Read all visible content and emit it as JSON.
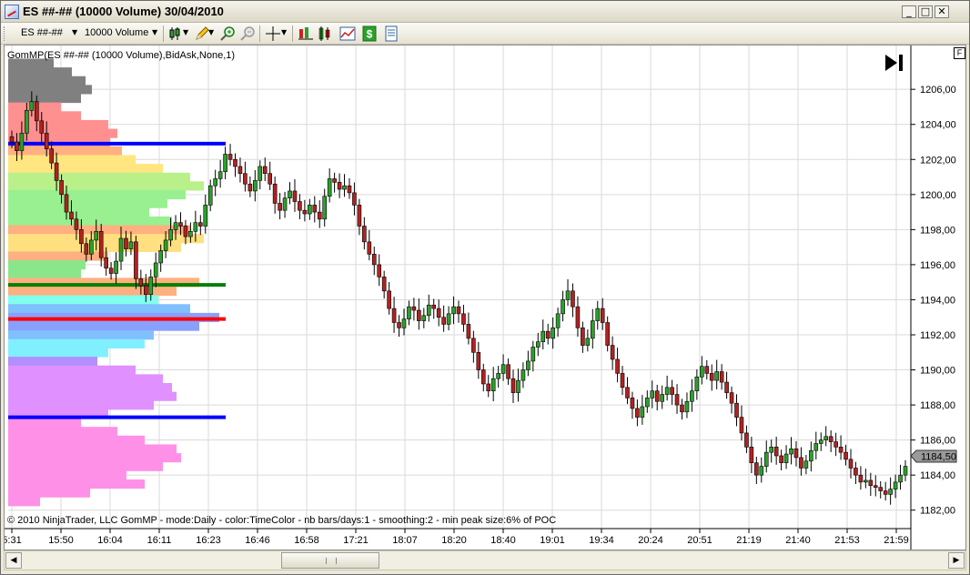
{
  "window": {
    "title": "ES ##-## (10000 Volume)  30/04/2010",
    "minimize": "_",
    "maximize": "□",
    "close": "✕"
  },
  "toolbar": {
    "instrument": "ES ##-##",
    "period": "10000 Volume",
    "icons": [
      "candlestick-icon",
      "pencil-icon",
      "zoom-in-icon",
      "zoom-out-icon",
      "crosshair-icon",
      "bar-type-icon",
      "indicators-icon",
      "strategy-icon",
      "dollar-icon",
      "properties-icon"
    ]
  },
  "chart": {
    "indicator_label": "GomMP(ES ##-## (10000 Volume),BidAsk,None,1)",
    "footer": "© 2010 NinjaTrader, LLC     GomMP - mode:Daily - color:TimeColor - nb bars/days:1 - smoothing:2 - min peak size:6% of POC",
    "f_button": "F",
    "last_price": "1184,50"
  },
  "chart_data": {
    "type": "candlestick",
    "instrument": "ES ##-##",
    "y_ticks": [
      "1206,00",
      "1204,00",
      "1202,00",
      "1200,00",
      "1198,00",
      "1196,00",
      "1194,00",
      "1192,00",
      "1190,00",
      "1188,00",
      "1186,00",
      "1184,00",
      "1182,00"
    ],
    "x_ticks": [
      "5:31",
      "15:50",
      "16:04",
      "16:11",
      "16:23",
      "16:46",
      "16:58",
      "17:21",
      "18:07",
      "18:20",
      "18:40",
      "19:01",
      "19:34",
      "20:24",
      "20:51",
      "21:19",
      "21:40",
      "21:53",
      "21:59"
    ],
    "ylim": [
      1181,
      1208.5
    ],
    "last": 1184.5,
    "levels": [
      {
        "price": 1202.9,
        "color": "#0000ff"
      },
      {
        "price": 1194.85,
        "color": "#008000"
      },
      {
        "price": 1192.9,
        "color": "#ff0000"
      },
      {
        "price": 1187.3,
        "color": "#0000ff"
      }
    ],
    "closes": [
      1203.0,
      1202.5,
      1203.5,
      1204.8,
      1205.3,
      1204.2,
      1203.5,
      1202.6,
      1201.8,
      1200.8,
      1200.0,
      1199.0,
      1198.6,
      1198.0,
      1197.2,
      1196.6,
      1197.4,
      1197.9,
      1196.4,
      1195.8,
      1195.5,
      1196.2,
      1197.5,
      1196.9,
      1197.3,
      1195.2,
      1194.8,
      1194.3,
      1195.3,
      1196.1,
      1196.8,
      1197.4,
      1198.0,
      1198.4,
      1198.2,
      1197.6,
      1197.9,
      1198.4,
      1198.2,
      1199.4,
      1200.5,
      1200.9,
      1201.3,
      1202.3,
      1202.0,
      1201.6,
      1201.2,
      1200.6,
      1200.2,
      1200.8,
      1201.6,
      1201.2,
      1200.6,
      1199.5,
      1199.1,
      1199.8,
      1200.2,
      1199.6,
      1199.1,
      1198.9,
      1199.4,
      1199.0,
      1198.6,
      1199.9,
      1200.9,
      1200.7,
      1200.3,
      1200.5,
      1200.1,
      1199.4,
      1198.2,
      1197.3,
      1196.6,
      1196.0,
      1195.3,
      1194.5,
      1193.5,
      1192.7,
      1192.4,
      1192.9,
      1193.6,
      1193.4,
      1192.8,
      1193.1,
      1193.7,
      1193.5,
      1193.0,
      1192.6,
      1193.2,
      1193.6,
      1193.2,
      1192.6,
      1191.8,
      1191.0,
      1190.0,
      1189.2,
      1188.8,
      1189.5,
      1189.8,
      1190.3,
      1189.5,
      1188.7,
      1189.4,
      1190.0,
      1190.5,
      1191.3,
      1191.6,
      1192.2,
      1191.8,
      1192.4,
      1193.2,
      1194.0,
      1194.5,
      1193.6,
      1192.4,
      1191.4,
      1191.8,
      1192.8,
      1193.5,
      1192.7,
      1191.4,
      1190.6,
      1189.8,
      1189.0,
      1188.4,
      1187.8,
      1187.3,
      1187.9,
      1188.4,
      1188.8,
      1188.2,
      1188.6,
      1189.0,
      1188.6,
      1188.0,
      1187.6,
      1188.2,
      1188.8,
      1189.6,
      1190.2,
      1189.8,
      1189.4,
      1189.9,
      1189.3,
      1188.7,
      1188.1,
      1187.3,
      1186.4,
      1185.6,
      1184.7,
      1184.0,
      1184.5,
      1185.3,
      1185.6,
      1185.1,
      1184.7,
      1185.2,
      1185.5,
      1185.0,
      1184.4,
      1184.8,
      1185.4,
      1185.8,
      1186.0,
      1186.2,
      1185.9,
      1185.6,
      1185.3,
      1184.9,
      1184.4,
      1184.0,
      1183.6,
      1183.7,
      1183.4,
      1183.3,
      1183.1,
      1182.9,
      1183.2,
      1183.6,
      1184.0,
      1184.5
    ],
    "profile_bins": [
      {
        "p": 1207.5,
        "w": 50,
        "c": "#808080"
      },
      {
        "p": 1207.0,
        "w": 70,
        "c": "#808080"
      },
      {
        "p": 1206.5,
        "w": 85,
        "c": "#808080"
      },
      {
        "p": 1206.0,
        "w": 92,
        "c": "#808080"
      },
      {
        "p": 1205.5,
        "w": 80,
        "c": "#808080"
      },
      {
        "p": 1205.0,
        "w": 58,
        "c": "#ff9090"
      },
      {
        "p": 1204.5,
        "w": 80,
        "c": "#ff9090"
      },
      {
        "p": 1204.0,
        "w": 110,
        "c": "#ff9090"
      },
      {
        "p": 1203.5,
        "w": 120,
        "c": "#ff9090"
      },
      {
        "p": 1203.0,
        "w": 112,
        "c": "#ff9090"
      },
      {
        "p": 1202.5,
        "w": 125,
        "c": "#ffb080"
      },
      {
        "p": 1202.0,
        "w": 140,
        "c": "#ffe680"
      },
      {
        "p": 1201.5,
        "w": 170,
        "c": "#ffe680"
      },
      {
        "p": 1201.0,
        "w": 200,
        "c": "#b9f08a"
      },
      {
        "p": 1200.5,
        "w": 215,
        "c": "#b9f08a"
      },
      {
        "p": 1200.0,
        "w": 195,
        "c": "#99f090"
      },
      {
        "p": 1199.5,
        "w": 175,
        "c": "#99f090"
      },
      {
        "p": 1199.0,
        "w": 155,
        "c": "#99f090"
      },
      {
        "p": 1198.5,
        "w": 180,
        "c": "#99f090"
      },
      {
        "p": 1198.0,
        "w": 200,
        "c": "#ffb080"
      },
      {
        "p": 1197.5,
        "w": 215,
        "c": "#ffe080"
      },
      {
        "p": 1197.0,
        "w": 190,
        "c": "#ffe080"
      },
      {
        "p": 1196.5,
        "w": 110,
        "c": "#ffb080"
      },
      {
        "p": 1196.0,
        "w": 85,
        "c": "#8ae68a"
      },
      {
        "p": 1195.5,
        "w": 80,
        "c": "#8ae68a"
      },
      {
        "p": 1195.0,
        "w": 210,
        "c": "#ffb080"
      },
      {
        "p": 1194.5,
        "w": 185,
        "c": "#ffb080"
      },
      {
        "p": 1194.0,
        "w": 165,
        "c": "#80ffee"
      },
      {
        "p": 1193.5,
        "w": 200,
        "c": "#80c0ff"
      },
      {
        "p": 1193.0,
        "w": 232,
        "c": "#8aa0ff"
      },
      {
        "p": 1192.5,
        "w": 210,
        "c": "#8aa0ff"
      },
      {
        "p": 1192.0,
        "w": 160,
        "c": "#80c0ff"
      },
      {
        "p": 1191.5,
        "w": 150,
        "c": "#80f0ff"
      },
      {
        "p": 1191.0,
        "w": 110,
        "c": "#80f0ff"
      },
      {
        "p": 1190.5,
        "w": 98,
        "c": "#b090ff"
      },
      {
        "p": 1190.0,
        "w": 140,
        "c": "#e090ff"
      },
      {
        "p": 1189.5,
        "w": 170,
        "c": "#e090ff"
      },
      {
        "p": 1189.0,
        "w": 180,
        "c": "#e090ff"
      },
      {
        "p": 1188.5,
        "w": 185,
        "c": "#e090ff"
      },
      {
        "p": 1188.0,
        "w": 160,
        "c": "#e090ff"
      },
      {
        "p": 1187.5,
        "w": 110,
        "c": "#e090ff"
      },
      {
        "p": 1187.0,
        "w": 80,
        "c": "#ff90e8"
      },
      {
        "p": 1186.5,
        "w": 120,
        "c": "#ff90e8"
      },
      {
        "p": 1186.0,
        "w": 150,
        "c": "#ff90e8"
      },
      {
        "p": 1185.5,
        "w": 185,
        "c": "#ff90e8"
      },
      {
        "p": 1185.0,
        "w": 190,
        "c": "#ff90e8"
      },
      {
        "p": 1184.5,
        "w": 170,
        "c": "#ff90e8"
      },
      {
        "p": 1184.0,
        "w": 130,
        "c": "#ff90e8"
      },
      {
        "p": 1183.5,
        "w": 150,
        "c": "#ff90e8"
      },
      {
        "p": 1183.0,
        "w": 90,
        "c": "#ff90e8"
      },
      {
        "p": 1182.5,
        "w": 35,
        "c": "#ff90e8"
      }
    ]
  }
}
